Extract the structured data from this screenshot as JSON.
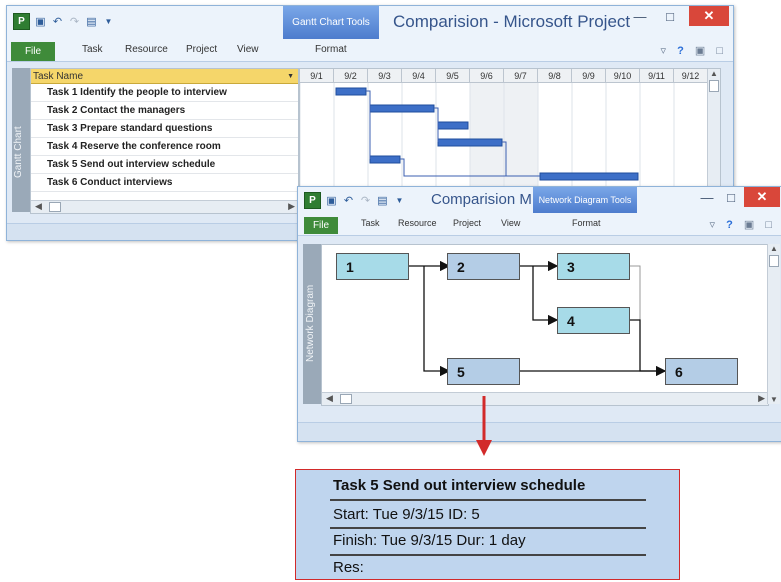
{
  "gantt_window": {
    "context_tab": "Gantt Chart Tools",
    "title": "Comparision - Microsoft Project",
    "tabs": [
      "File",
      "Task",
      "Resource",
      "Project",
      "View"
    ],
    "format_tab": "Format",
    "view_bar_label": "Gantt Chart",
    "table_header": "Task Name",
    "tasks": [
      "Task 1  Identify the people to interview",
      "Task 2  Contact the managers",
      "Task 3  Prepare standard questions",
      "Task 4  Reserve the conference room",
      "Task 5  Send out interview schedule",
      "Task 6  Conduct interviews"
    ],
    "dates": [
      "9/1",
      "9/2",
      "9/3",
      "9/4",
      "9/5",
      "9/6",
      "9/7",
      "9/8",
      "9/9",
      "9/10",
      "9/11",
      "9/12"
    ]
  },
  "network_window": {
    "title": "Comparision M...",
    "context_tab": "Network Diagram Tools",
    "tabs": [
      "File",
      "Task",
      "Resource",
      "Project",
      "View"
    ],
    "format_tab": "Format",
    "view_bar_label": "Network Diagram",
    "nodes": [
      "1",
      "2",
      "3",
      "4",
      "5",
      "6"
    ]
  },
  "detail": {
    "task": "Task 5  Send out interview schedule",
    "start": "Start:  Tue 9/3/15   ID:  5",
    "finish": "Finish: Tue 9/3/15  Dur: 1 day",
    "res": "Res:"
  },
  "colors": {
    "critical_node": "#a7dbe8",
    "normal_node": "#b4cde6",
    "gantt_bar": "#3d6fc7",
    "callout_arrow": "#d22a2a",
    "file_tab": "#3f8b3a",
    "context_tab": "#5b8ad6"
  }
}
